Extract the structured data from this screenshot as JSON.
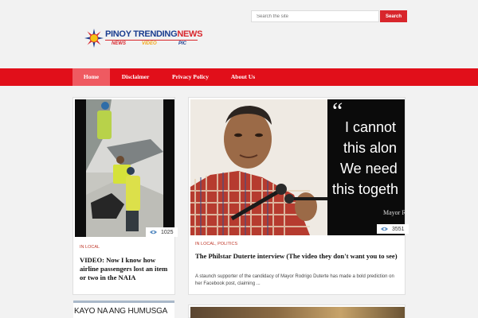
{
  "search": {
    "placeholder": "Search the site",
    "button_label": "Search"
  },
  "logo": {
    "title_part1": "PINOY TRENDING",
    "title_part2": "NEWS",
    "sub_news": "NEWS",
    "sub_video": "VIDEO",
    "sub_pic": "PIC"
  },
  "nav": {
    "items": [
      "Home",
      "Disclaimer",
      "Privacy Policy",
      "About Us"
    ],
    "active": "Home"
  },
  "posts": [
    {
      "views": "1025",
      "category": "IN LOCAL",
      "title": "VIDEO: Now I know how airline passengers lost an item or two in the NAIA"
    },
    {
      "views": "3551",
      "category": "IN LOCAL, POLITICS",
      "title": "The Philstar Duterte interview (The video they don't want you to see)",
      "excerpt": "A staunch supporter of the candidacy of Mayor Rodrigo Duterte has made a bold prediction on her Facebook post, claiming ...",
      "quote_mark": "“",
      "quote_lines": [
        "I cannot",
        "this alon",
        "We need",
        "this togeth"
      ],
      "quote_attr": "Mayor R"
    }
  ],
  "widget": {
    "heading": "KAYO NA ANG HUMUSGA"
  },
  "colors": {
    "accent": "#e10f1a",
    "active_nav": "#ef5a61",
    "category": "#c0392b",
    "search_button": "#d8262c"
  },
  "icons": {
    "views": "eye-icon"
  }
}
